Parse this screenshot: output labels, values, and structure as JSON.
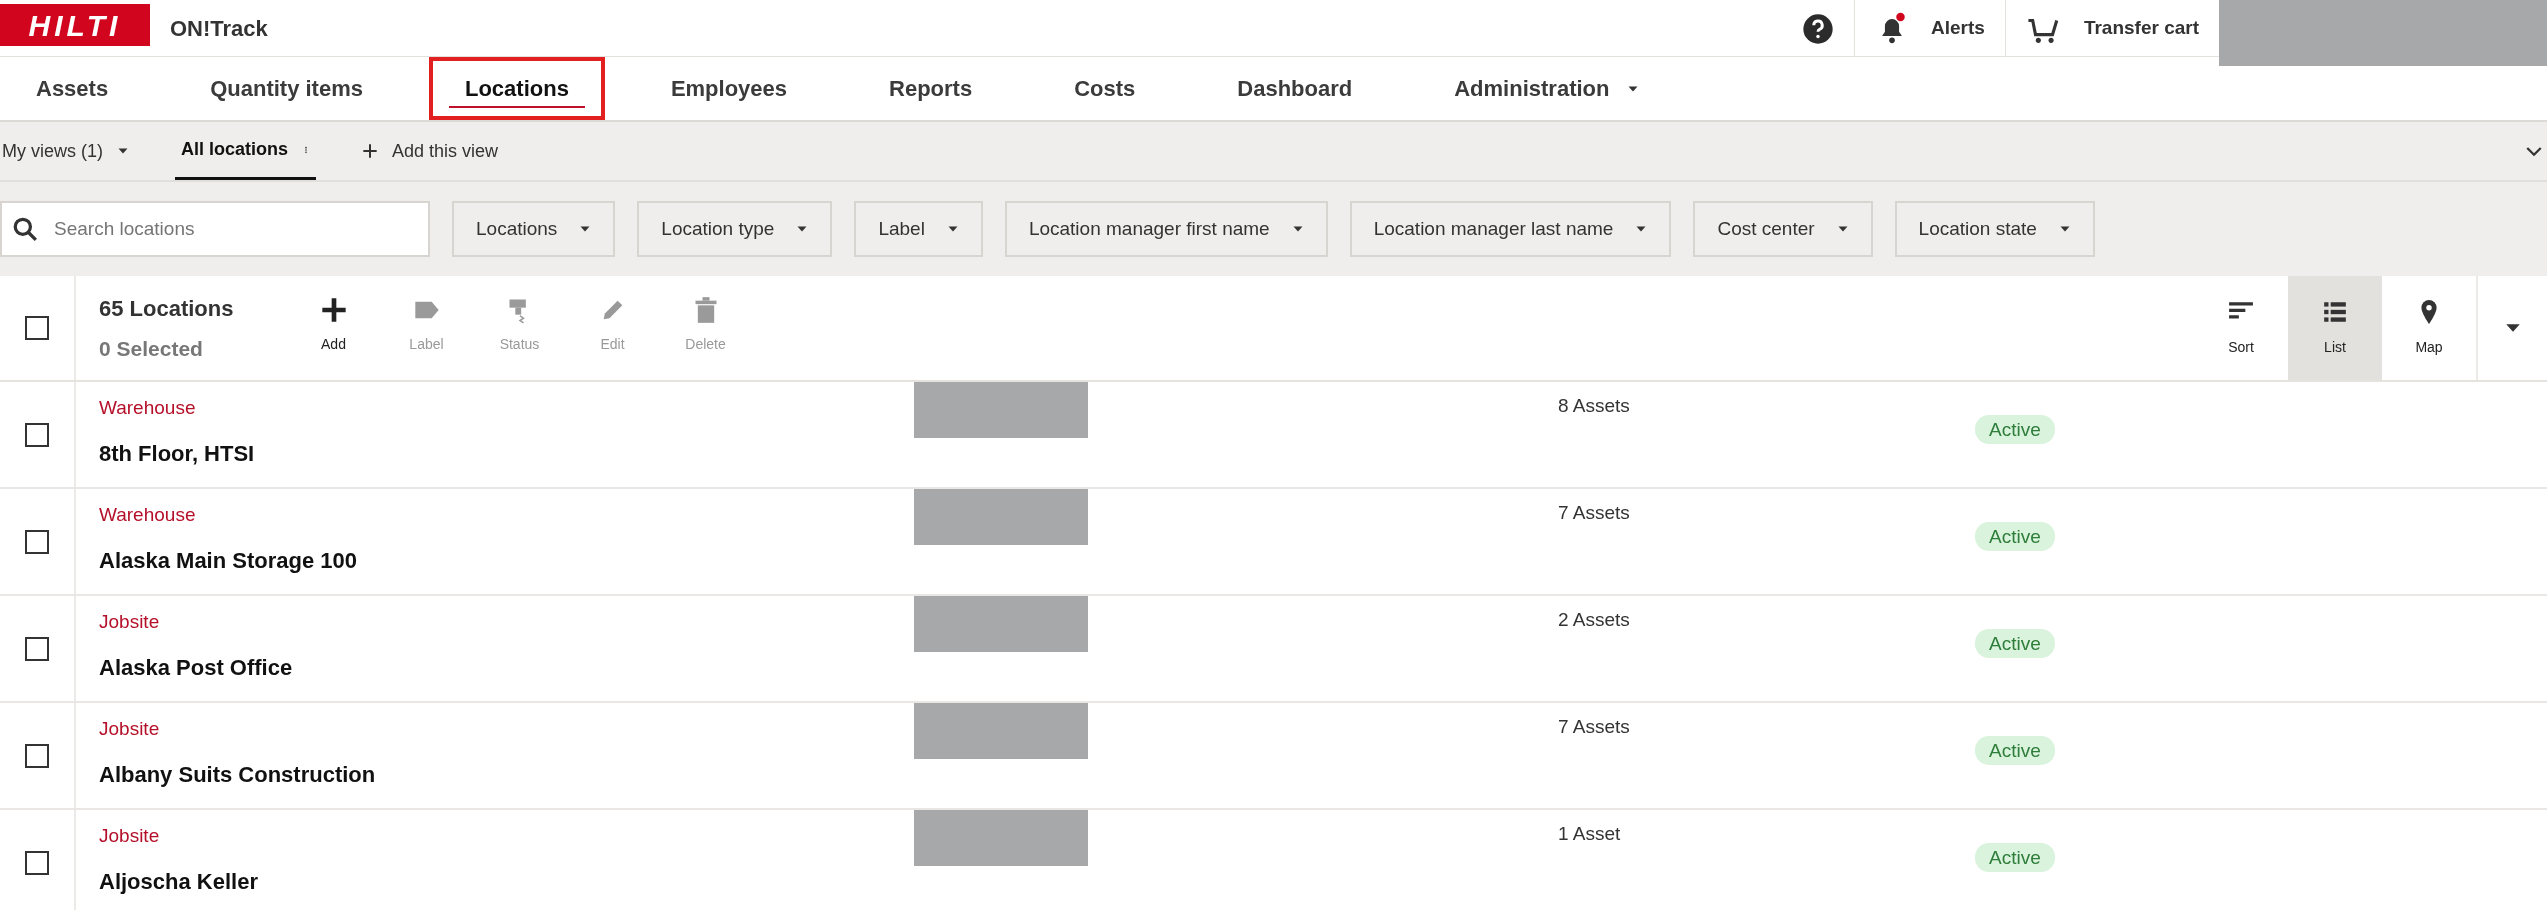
{
  "header": {
    "logo": "HILTI",
    "app_name": "ON!Track",
    "alerts": {
      "label": "Alerts",
      "has_new": true
    },
    "cart": {
      "label": "Transfer cart"
    },
    "account_redacted": true
  },
  "tabs": [
    {
      "label": "Assets",
      "selected": false,
      "highlighted": false,
      "has_menu": false
    },
    {
      "label": "Quantity items",
      "selected": false,
      "highlighted": false,
      "has_menu": false
    },
    {
      "label": "Locations",
      "selected": true,
      "highlighted": true,
      "has_menu": false
    },
    {
      "label": "Employees",
      "selected": false,
      "highlighted": false,
      "has_menu": false
    },
    {
      "label": "Reports",
      "selected": false,
      "highlighted": false,
      "has_menu": false
    },
    {
      "label": "Costs",
      "selected": false,
      "highlighted": false,
      "has_menu": false
    },
    {
      "label": "Dashboard",
      "selected": false,
      "highlighted": false,
      "has_menu": false
    },
    {
      "label": "Administration",
      "selected": false,
      "highlighted": false,
      "has_menu": true
    }
  ],
  "views": {
    "my_views": "My views (1)",
    "items": [
      {
        "label": "All locations",
        "selected": true
      }
    ],
    "add_label": "Add this view"
  },
  "search": {
    "placeholder": "Search locations"
  },
  "filters": [
    "Locations",
    "Location type",
    "Label",
    "Location manager first name",
    "Location manager last name",
    "Cost center",
    "Location state"
  ],
  "toolbar": {
    "count": "65 Locations",
    "selected_count": "0 Selected",
    "all_checked": false,
    "actions": [
      {
        "kind": "add",
        "label": "Add",
        "disabled": false
      },
      {
        "kind": "label",
        "label": "Label",
        "disabled": true
      },
      {
        "kind": "status",
        "label": "Status",
        "disabled": true
      },
      {
        "kind": "edit",
        "label": "Edit",
        "disabled": true
      },
      {
        "kind": "delete",
        "label": "Delete",
        "disabled": true
      }
    ],
    "modes": [
      {
        "kind": "sort",
        "label": "Sort",
        "selected": false
      },
      {
        "kind": "list",
        "label": "List",
        "selected": true
      },
      {
        "kind": "map",
        "label": "Map",
        "selected": false
      }
    ]
  },
  "rows": [
    {
      "type": "Warehouse",
      "name": "8th Floor, HTSI",
      "assets": "8 Assets",
      "state": "Active",
      "checked": false
    },
    {
      "type": "Warehouse",
      "name": "Alaska Main Storage 100",
      "assets": "7 Assets",
      "state": "Active",
      "checked": false
    },
    {
      "type": "Jobsite",
      "name": "Alaska Post Office",
      "assets": "2 Assets",
      "state": "Active",
      "checked": false
    },
    {
      "type": "Jobsite",
      "name": "Albany Suits Construction",
      "assets": "7 Assets",
      "state": "Active",
      "checked": false
    },
    {
      "type": "Jobsite",
      "name": "Aljoscha Keller",
      "assets": "1 Asset",
      "state": "Active",
      "checked": false
    }
  ]
}
